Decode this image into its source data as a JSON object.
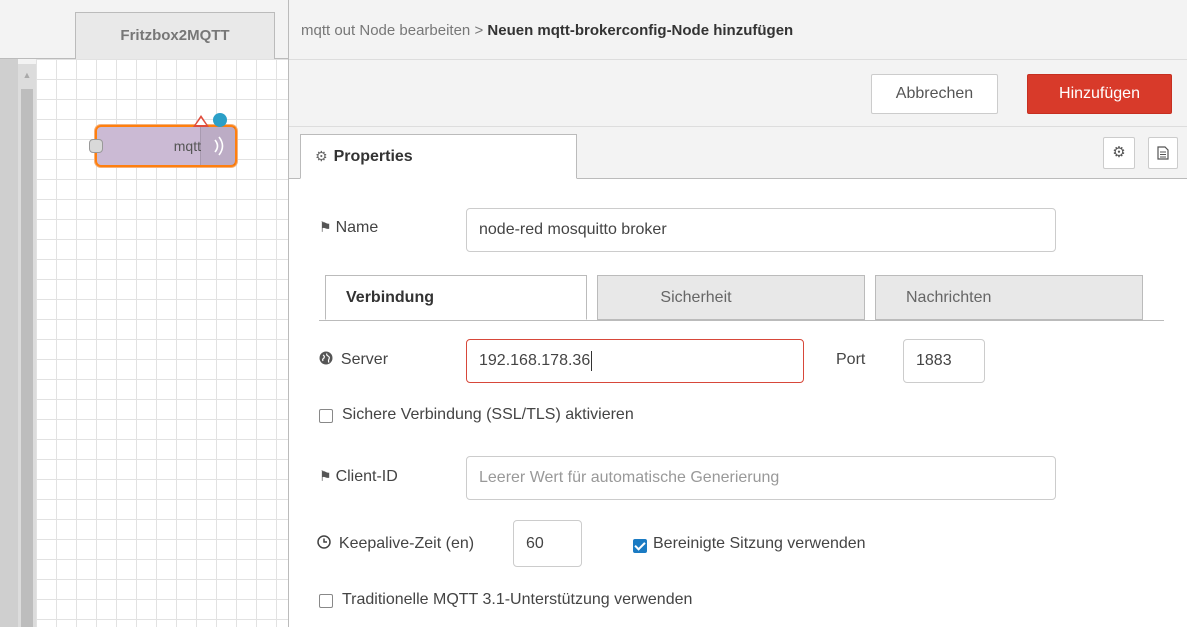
{
  "workspace": {
    "flow_tab_label": "Fritzbox2MQTT",
    "node": {
      "label": "mqtt",
      "type": "mqtt out"
    }
  },
  "editor": {
    "breadcrumb_parent": "mqtt out Node bearbeiten",
    "breadcrumb_separator": ">",
    "breadcrumb_current": "Neuen mqtt-brokerconfig-Node hinzufügen",
    "cancel_label": "Abbrechen",
    "add_label": "Hinzufügen",
    "add_color": "#d83a2a",
    "properties_tab_label": "Properties"
  },
  "form": {
    "name_label": "Name",
    "name_value": "node-red mosquitto broker",
    "tabs": [
      "Verbindung",
      "Sicherheit",
      "Nachrichten"
    ],
    "active_tab": "Verbindung",
    "server_label": "Server",
    "server_value": "192.168.178.36",
    "port_label": "Port",
    "port_value": "1883",
    "ssl_label": "Sichere Verbindung (SSL/TLS) aktivieren",
    "ssl_checked": false,
    "client_id_label": "Client-ID",
    "client_id_placeholder": "Leerer Wert für automatische Generierung",
    "keepalive_label": "Keepalive-Zeit (en)",
    "keepalive_value": "60",
    "clean_session_label": "Bereinigte Sitzung verwenden",
    "clean_session_checked": true,
    "legacy_label": "Traditionelle MQTT 3.1-Unterstützung verwenden",
    "legacy_checked": false
  },
  "icons": {
    "tag": "tag-icon",
    "globe": "globe-icon",
    "clock": "clock-icon",
    "gear": "gear-icon",
    "document": "document-icon"
  }
}
